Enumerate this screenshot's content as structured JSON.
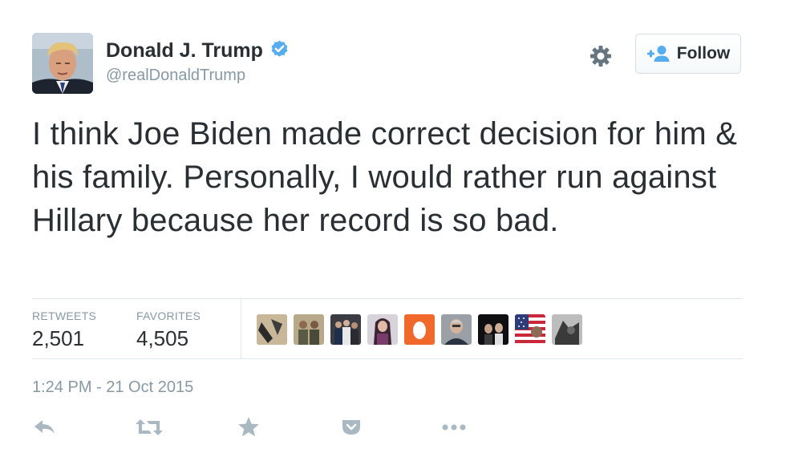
{
  "author": {
    "display_name": "Donald J. Trump",
    "handle": "@realDonaldTrump",
    "verified": true,
    "avatar_icon": "profile-photo"
  },
  "header": {
    "follow_label": "Follow",
    "settings_icon": "gear-icon",
    "follow_icon": "add-user-icon"
  },
  "tweet": {
    "text": "I think Joe Biden made correct decision for him & his family. Personally, I would rather run against Hillary because her record is so bad."
  },
  "stats": {
    "retweets_label": "RETWEETS",
    "retweets_value": "2,501",
    "favorites_label": "FAVORITES",
    "favorites_value": "4,505"
  },
  "favoriters": [
    {
      "icon": "user-avatar"
    },
    {
      "icon": "user-avatar"
    },
    {
      "icon": "user-avatar"
    },
    {
      "icon": "user-avatar"
    },
    {
      "icon": "default-egg-avatar"
    },
    {
      "icon": "user-avatar"
    },
    {
      "icon": "user-avatar"
    },
    {
      "icon": "flag-avatar"
    },
    {
      "icon": "user-avatar"
    }
  ],
  "timestamp": "1:24 PM - 21 Oct 2015",
  "actions": [
    "reply-icon",
    "retweet-icon",
    "favorite-icon",
    "pocket-icon",
    "more-icon"
  ],
  "colors": {
    "text": "#292f33",
    "muted": "#8899a6",
    "verified": "#55acee",
    "border": "#e1e8ed",
    "icon": "#aab8c2"
  }
}
